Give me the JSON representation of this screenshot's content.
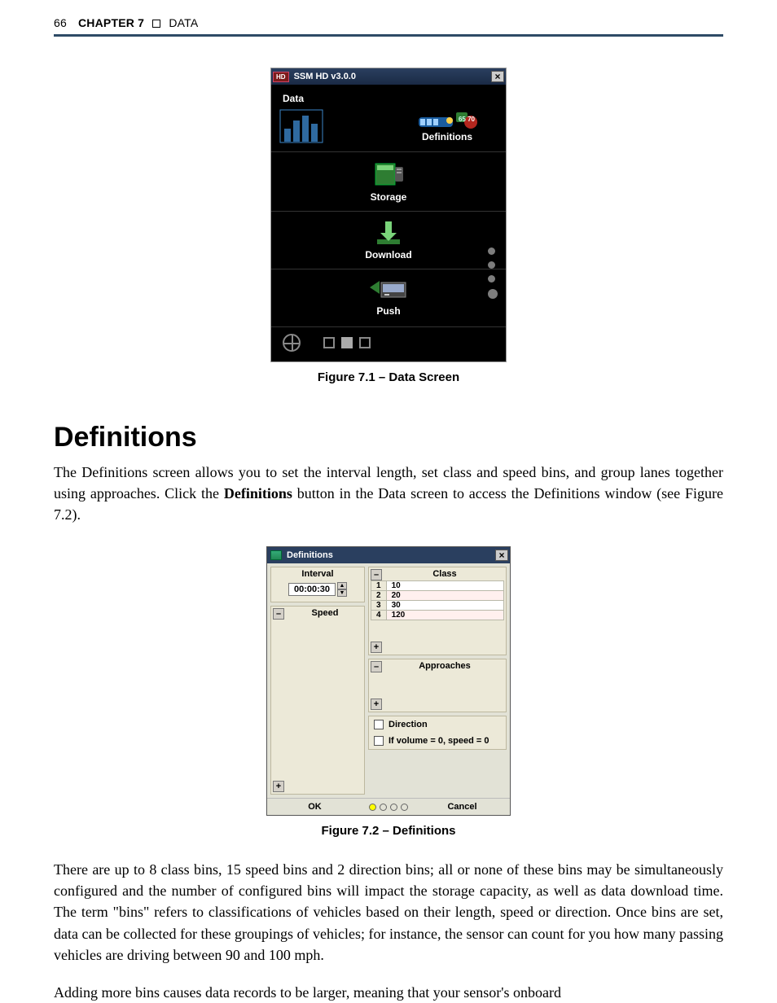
{
  "header": {
    "page_number": "66",
    "chapter": "CHAPTER 7",
    "section": "DATA"
  },
  "fig1": {
    "app_title": "SSM HD v3.0.0",
    "hd_badge": "HD",
    "close": "×",
    "tab": "Data",
    "btn_definitions": "Definitions",
    "btn_storage": "Storage",
    "btn_download": "Download",
    "btn_push": "Push",
    "speed_badge_a": "65",
    "speed_badge_b": "70",
    "caption": "Figure 7.1 – Data Screen"
  },
  "section_heading": "Definitions",
  "para1_a": "The Definitions screen allows you to set the interval length, set class and speed bins, and group lanes together using approaches. Click the ",
  "para1_bold": "Definitions",
  "para1_b": " button in the Data screen to access the Definitions window (see Figure 7.2).",
  "fig2": {
    "title": "Definitions",
    "close": "×",
    "interval_label": "Interval",
    "interval_value": "00:00:30",
    "speed_label": "Speed",
    "class_label": "Class",
    "class_rows": [
      {
        "n": "1",
        "v": "10"
      },
      {
        "n": "2",
        "v": "20"
      },
      {
        "n": "3",
        "v": "30"
      },
      {
        "n": "4",
        "v": "120"
      }
    ],
    "approaches_label": "Approaches",
    "direction_label": "Direction",
    "ifvol_label": "If volume = 0, speed = 0",
    "ok": "OK",
    "cancel": "Cancel",
    "minus": "–",
    "plus": "+",
    "caption": "Figure 7.2 – Definitions"
  },
  "para2": "There are up to 8 class bins, 15 speed bins and 2 direction bins; all or none of these bins may be simultaneously configured and the number of configured bins will impact the storage capacity, as well as data download time. The term \"bins\" refers to classifications of vehicles based on their length, speed or direction. Once bins are set, data can be collected for these groupings of vehicles; for instance, the sensor can count for you how many passing vehicles are driving between 90 and 100 mph.",
  "para3": "Adding more bins causes data records to be larger, meaning that your sensor's onboard"
}
